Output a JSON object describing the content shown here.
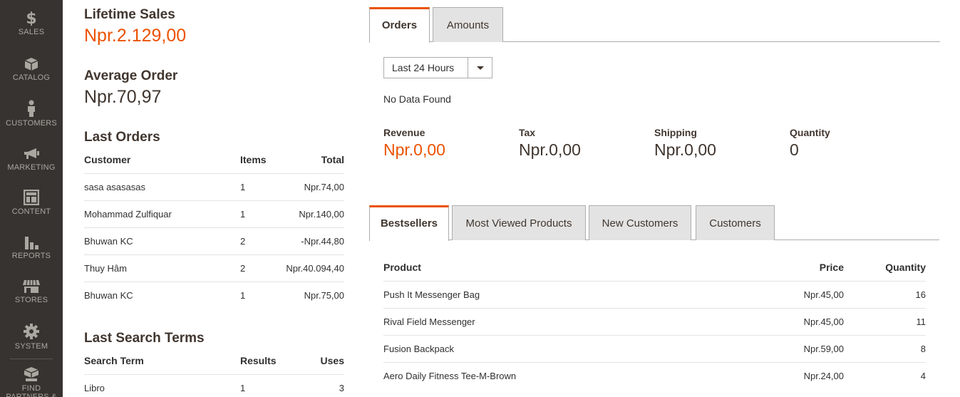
{
  "sidebar": {
    "items": [
      {
        "label": "SALES",
        "icon": "dollar-icon"
      },
      {
        "label": "CATALOG",
        "icon": "cube-icon"
      },
      {
        "label": "CUSTOMERS",
        "icon": "person-icon"
      },
      {
        "label": "MARKETING",
        "icon": "megaphone-icon"
      },
      {
        "label": "CONTENT",
        "icon": "layout-icon"
      },
      {
        "label": "REPORTS",
        "icon": "bar-chart-icon"
      },
      {
        "label": "STORES",
        "icon": "storefront-icon"
      },
      {
        "label": "SYSTEM",
        "icon": "gear-icon"
      },
      {
        "label": "FIND PARTNERS & EXTENSIONS",
        "icon": "boxes-icon"
      }
    ]
  },
  "lifetime_sales": {
    "title": "Lifetime Sales",
    "value": "Npr.2.129,00"
  },
  "average_order": {
    "title": "Average Order",
    "value": "Npr.70,97"
  },
  "last_orders": {
    "title": "Last Orders",
    "headers": {
      "customer": "Customer",
      "items": "Items",
      "total": "Total"
    },
    "rows": [
      {
        "customer": "sasa asasasas",
        "items": "1",
        "total": "Npr.74,00"
      },
      {
        "customer": "Mohammad Zulfiquar",
        "items": "1",
        "total": "Npr.140,00"
      },
      {
        "customer": "Bhuwan KC",
        "items": "2",
        "total": "-Npr.44,80"
      },
      {
        "customer": "Thuy Hâm",
        "items": "2",
        "total": "Npr.40.094,40"
      },
      {
        "customer": "Bhuwan KC",
        "items": "1",
        "total": "Npr.75,00"
      }
    ]
  },
  "last_search": {
    "title": "Last Search Terms",
    "headers": {
      "term": "Search Term",
      "results": "Results",
      "uses": "Uses"
    },
    "rows": [
      {
        "term": "Libro",
        "results": "1",
        "uses": "3"
      }
    ]
  },
  "chart_tabs": {
    "orders": "Orders",
    "amounts": "Amounts"
  },
  "period_select": {
    "value": "Last 24 Hours"
  },
  "no_data": "No Data Found",
  "totals": {
    "revenue": {
      "label": "Revenue",
      "value": "Npr.0,00"
    },
    "tax": {
      "label": "Tax",
      "value": "Npr.0,00"
    },
    "shipping": {
      "label": "Shipping",
      "value": "Npr.0,00"
    },
    "quantity": {
      "label": "Quantity",
      "value": "0"
    }
  },
  "grid_tabs": {
    "bestsellers": "Bestsellers",
    "most_viewed": "Most Viewed Products",
    "new_customers": "New Customers",
    "customers": "Customers"
  },
  "bestsellers": {
    "headers": {
      "product": "Product",
      "price": "Price",
      "quantity": "Quantity"
    },
    "rows": [
      {
        "product": "Push It Messenger Bag",
        "price": "Npr.45,00",
        "quantity": "16"
      },
      {
        "product": "Rival Field Messenger",
        "price": "Npr.45,00",
        "quantity": "11"
      },
      {
        "product": "Fusion Backpack",
        "price": "Npr.59,00",
        "quantity": "8"
      },
      {
        "product": "Aero Daily Fitness Tee-M-Brown",
        "price": "Npr.24,00",
        "quantity": "4"
      }
    ]
  },
  "colors": {
    "accent": "#eb5202",
    "sidebar": "#373330",
    "text": "#41362f"
  }
}
